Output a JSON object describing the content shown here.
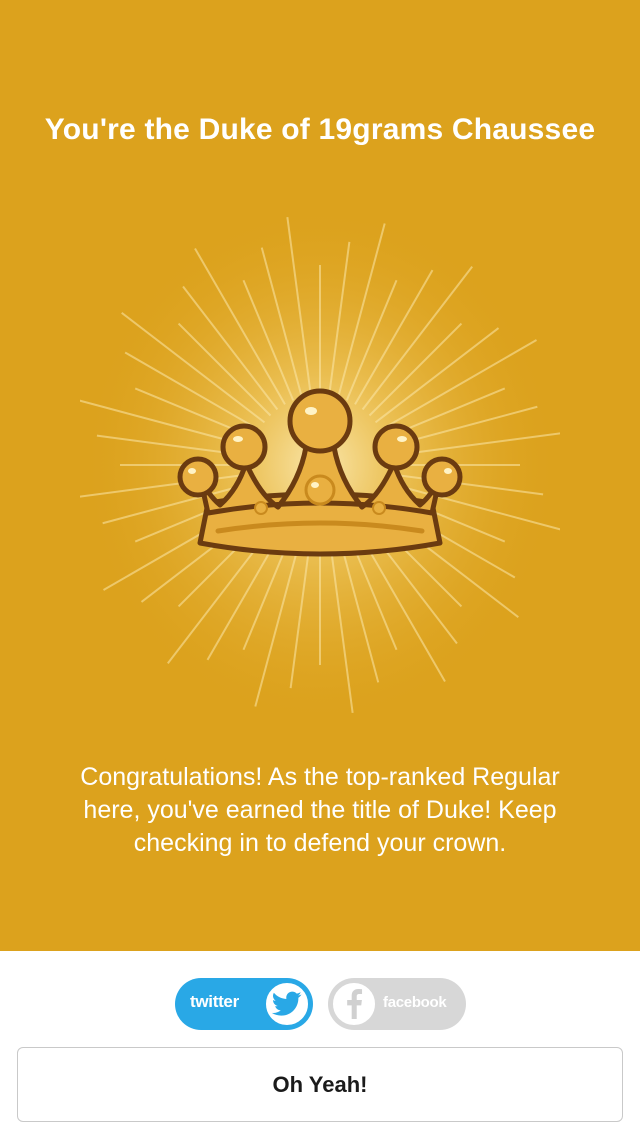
{
  "colors": {
    "hero_background": "#dca21d",
    "twitter_blue": "#29a8e6",
    "facebook_gray": "#d7d7d7",
    "crown_gold": "#e9b041",
    "crown_outline": "#6b3b10"
  },
  "header": {
    "title": "You're the Duke of 19grams Chaussee"
  },
  "badge": {
    "icon": "crown-icon"
  },
  "message": {
    "text": "Congratulations! As the top-ranked Regular here, you've earned the title of Duke! Keep checking in to defend your crown."
  },
  "share": {
    "twitter_label": "twitter",
    "twitter_icon": "twitter-bird-icon",
    "facebook_label": "facebook",
    "facebook_icon": "facebook-f-icon"
  },
  "actions": {
    "confirm_label": "Oh Yeah!"
  }
}
